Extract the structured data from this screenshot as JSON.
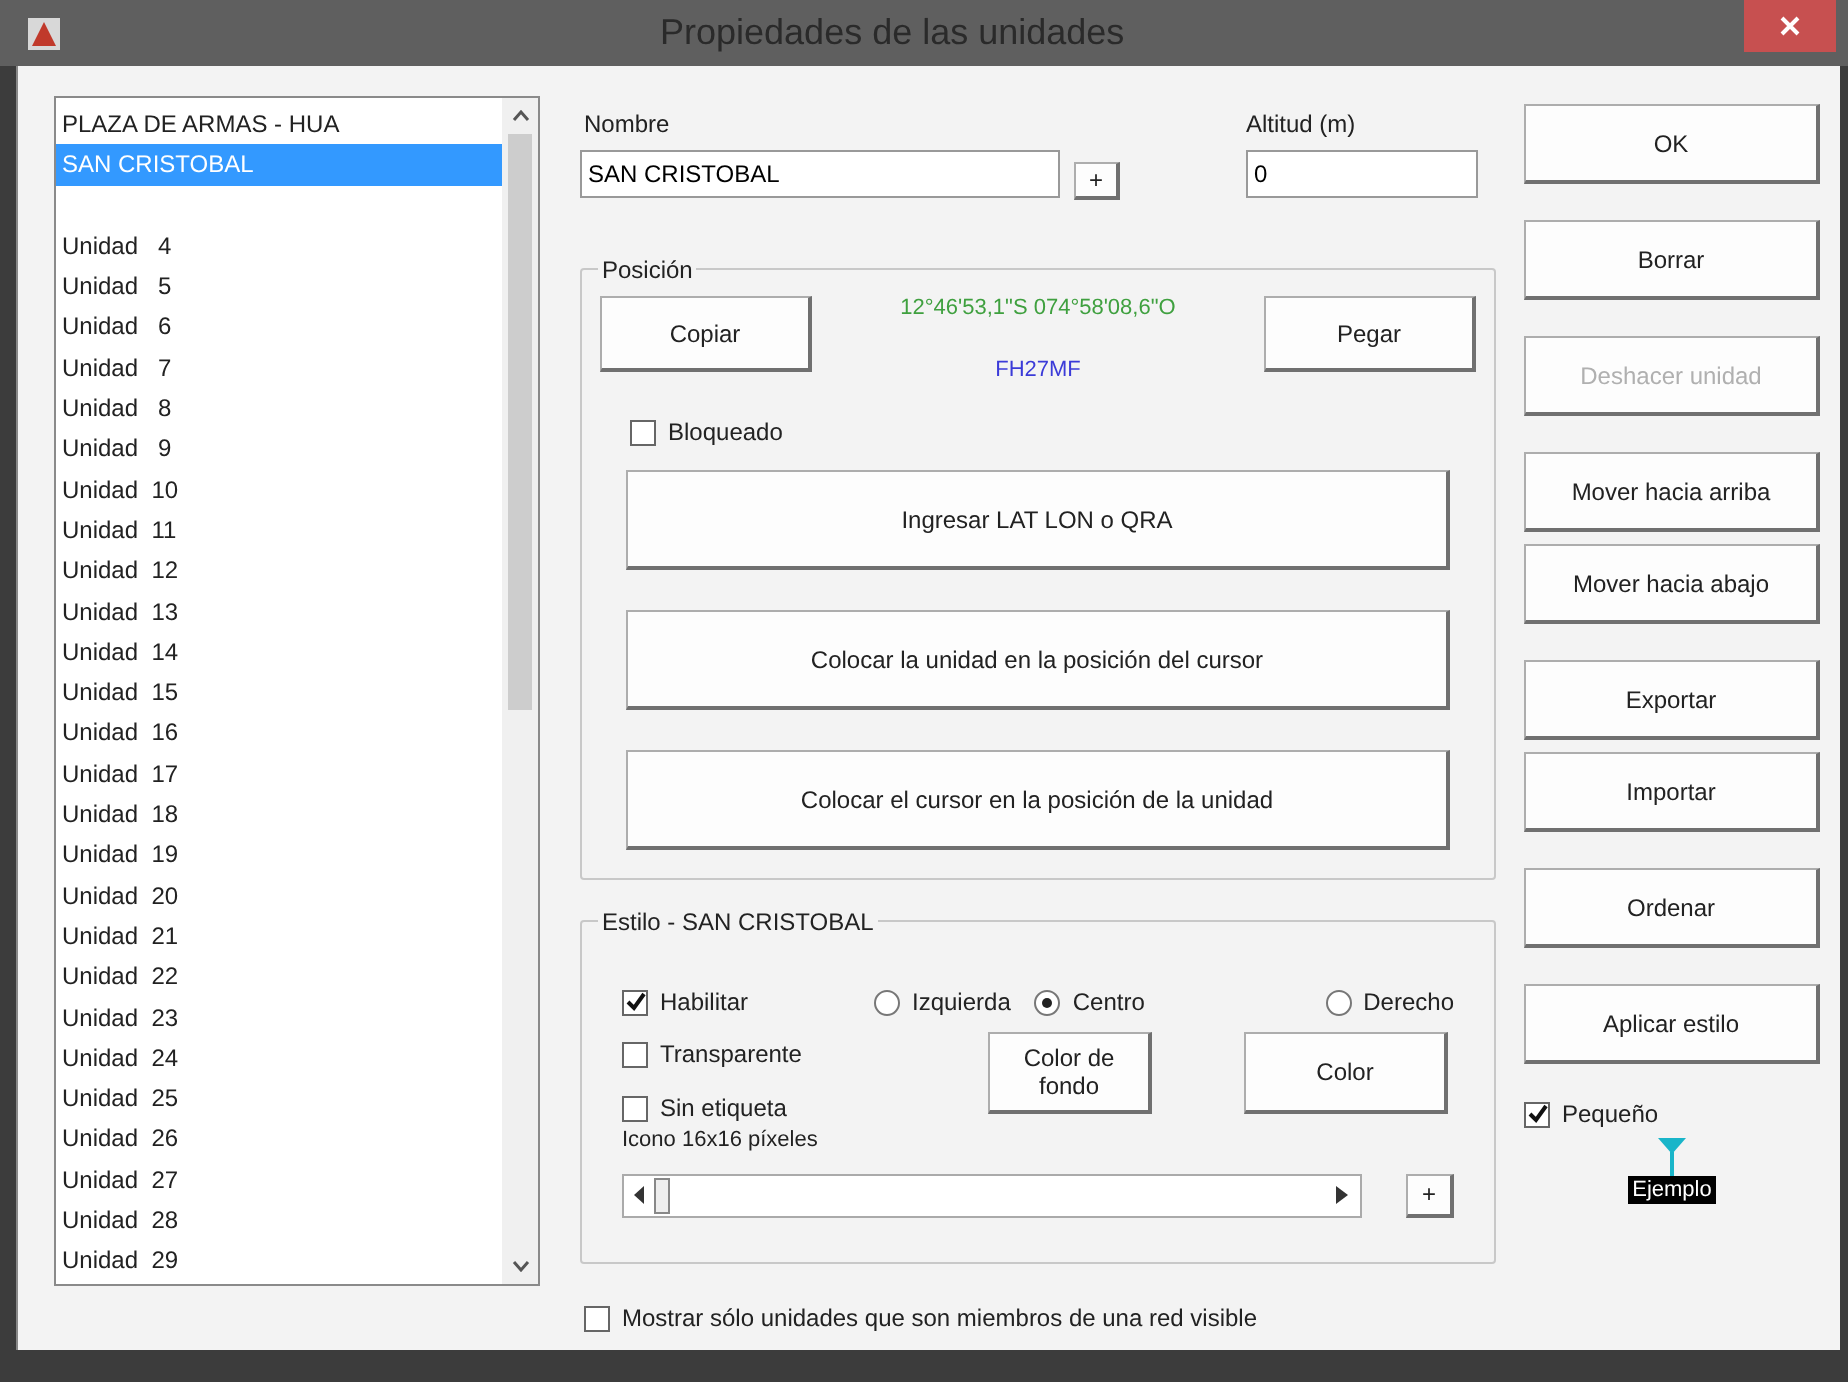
{
  "window": {
    "title": "Propiedades de las unidades"
  },
  "unit_list": {
    "items": [
      {
        "label": "PLAZA DE ARMAS - HUA",
        "selected": false
      },
      {
        "label": "SAN CRISTOBAL",
        "selected": true
      },
      {
        "selected": false
      },
      {
        "label": "Unidad   4",
        "selected": false
      },
      {
        "label": "Unidad   5",
        "selected": false
      },
      {
        "label": "Unidad   6",
        "selected": false
      },
      {
        "label": "Unidad   7",
        "selected": false
      },
      {
        "label": "Unidad   8",
        "selected": false
      },
      {
        "label": "Unidad   9",
        "selected": false
      },
      {
        "label": "Unidad  10",
        "selected": false
      },
      {
        "label": "Unidad  11",
        "selected": false
      },
      {
        "label": "Unidad  12",
        "selected": false
      },
      {
        "label": "Unidad  13",
        "selected": false
      },
      {
        "label": "Unidad  14",
        "selected": false
      },
      {
        "label": "Unidad  15",
        "selected": false
      },
      {
        "label": "Unidad  16",
        "selected": false
      },
      {
        "label": "Unidad  17",
        "selected": false
      },
      {
        "label": "Unidad  18",
        "selected": false
      },
      {
        "label": "Unidad  19",
        "selected": false
      },
      {
        "label": "Unidad  20",
        "selected": false
      },
      {
        "label": "Unidad  21",
        "selected": false
      },
      {
        "label": "Unidad  22",
        "selected": false
      },
      {
        "label": "Unidad  23",
        "selected": false
      },
      {
        "label": "Unidad  24",
        "selected": false
      },
      {
        "label": "Unidad  25",
        "selected": false
      },
      {
        "label": "Unidad  26",
        "selected": false
      },
      {
        "label": "Unidad  27",
        "selected": false
      },
      {
        "label": "Unidad  28",
        "selected": false
      },
      {
        "label": "Unidad  29",
        "selected": false
      }
    ]
  },
  "name": {
    "label": "Nombre",
    "value": "SAN CRISTOBAL",
    "button": "+"
  },
  "altitude": {
    "label": "Altitud (m)",
    "value": "0"
  },
  "position": {
    "title": "Posición",
    "copy": "Copiar",
    "paste": "Pegar",
    "coordinates": "12°46'53,1\"S 074°58'08,6\"O",
    "locator": "FH27MF",
    "locked": {
      "label": "Bloqueado",
      "checked": false
    },
    "actions": [
      "Ingresar LAT LON o QRA",
      "Colocar la unidad en la posición del cursor",
      "Colocar el cursor en la posición de la unidad"
    ]
  },
  "style": {
    "title": "Estilo - SAN CRISTOBAL",
    "enable": {
      "label": "Habilitar",
      "checked": true
    },
    "alignment": [
      {
        "label": "Izquierda",
        "selected": false
      },
      {
        "label": "Centro",
        "selected": true
      },
      {
        "label": "Derecho",
        "selected": false
      }
    ],
    "options": [
      {
        "label": "Transparente",
        "checked": false
      },
      {
        "label": "Sin etiqueta",
        "checked": false
      }
    ],
    "background_color": "Color de fondo",
    "color_button": "Color",
    "icon_label": "Icono 16x16 píxeles",
    "icon_size": {
      "level": 0
    },
    "plus": "+"
  },
  "show_only_visible": {
    "label": "Mostrar sólo unidades que son miembros de una red visible",
    "checked": false
  },
  "buttons": [
    {
      "label": "OK",
      "disabled": false
    },
    {
      "label": "Borrar",
      "disabled": false
    },
    {
      "label": "Deshacer unidad",
      "disabled": true
    },
    {
      "label": "Mover hacia arriba",
      "disabled": false
    },
    {
      "label": "Mover hacia abajo",
      "disabled": false
    },
    {
      "label": "Exportar",
      "disabled": false
    },
    {
      "label": "Importar",
      "disabled": false
    },
    {
      "label": "Ordenar",
      "disabled": false
    },
    {
      "label": "Aplicar estilo",
      "disabled": false
    }
  ],
  "small": {
    "label": "Pequeño",
    "checked": true
  },
  "preview": {
    "label": "Ejemplo"
  }
}
